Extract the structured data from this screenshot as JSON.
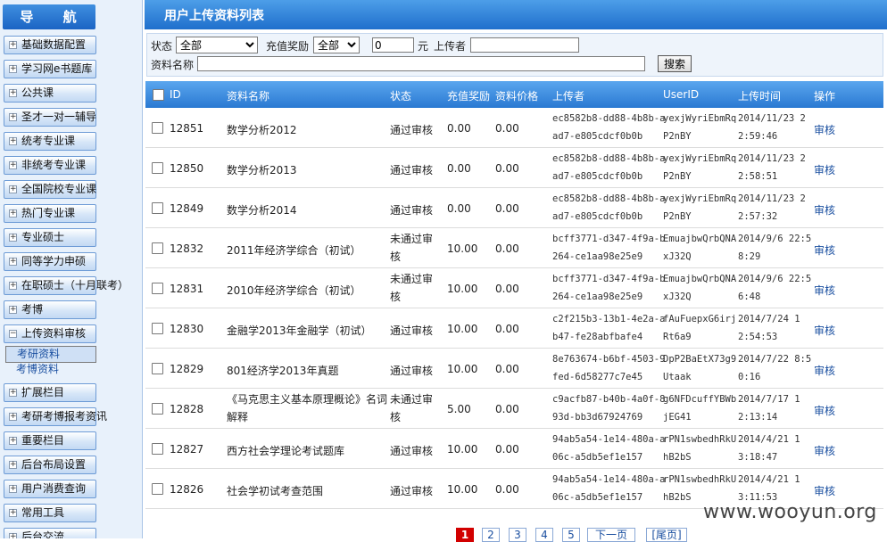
{
  "nav": {
    "title": "导 航",
    "items": [
      {
        "label": "基础数据配置",
        "sign": "+"
      },
      {
        "label": "学习网e书题库",
        "sign": "+"
      },
      {
        "label": "公共课",
        "sign": "+"
      },
      {
        "label": "圣才一对一辅导",
        "sign": "+"
      },
      {
        "label": "统考专业课",
        "sign": "+"
      },
      {
        "label": "非统考专业课",
        "sign": "+"
      },
      {
        "label": "全国院校专业课",
        "sign": "+"
      },
      {
        "label": "热门专业课",
        "sign": "+"
      },
      {
        "label": "专业硕士",
        "sign": "+"
      },
      {
        "label": "同等学力申硕",
        "sign": "+"
      },
      {
        "label": "在职硕士（十月联考）",
        "sign": "+"
      },
      {
        "label": "考博",
        "sign": "+"
      },
      {
        "label": "上传资料审核",
        "sign": "−"
      },
      {
        "label": "扩展栏目",
        "sign": "+"
      },
      {
        "label": "考研考博报考资讯",
        "sign": "+"
      },
      {
        "label": "重要栏目",
        "sign": "+"
      },
      {
        "label": "后台布局设置",
        "sign": "+"
      },
      {
        "label": "用户消费查询",
        "sign": "+"
      },
      {
        "label": "常用工具",
        "sign": "+"
      },
      {
        "label": "后台交流",
        "sign": "+"
      }
    ],
    "sub_items": [
      {
        "label": "考研资料"
      },
      {
        "label": "考博资料"
      }
    ]
  },
  "page": {
    "title": "用户上传资料列表"
  },
  "filters": {
    "status_label": "状态",
    "status_value": "全部",
    "reward_label": "充值奖励",
    "reward_value": "全部",
    "amount_value": "0",
    "yuan_label": "元",
    "uploader_label": "上传者",
    "uploader_value": "",
    "name_label": "资料名称",
    "name_value": "",
    "search_label": "搜索"
  },
  "table": {
    "headers": {
      "id": "ID",
      "name": "资料名称",
      "status": "状态",
      "reward": "充值奖励",
      "price": "资料价格",
      "uploader": "上传者",
      "userid": "UserID",
      "time": "上传时间",
      "action": "操作"
    },
    "rows": [
      {
        "id": "12851",
        "name1": "数学分析2012",
        "name2": "",
        "status1": "通过审核",
        "status2": "",
        "reward": "0.00",
        "price": "0.00",
        "up1": "ec8582b8-dd88-4b8b-a",
        "up2": "ad7-e805cdcf0b0b",
        "uid1": "yexjWyriEbmRq",
        "uid2": "P2nBY",
        "t1": "2014/11/23 2",
        "t2": "2:59:46",
        "action": "审核"
      },
      {
        "id": "12850",
        "name1": "数学分析2013",
        "name2": "",
        "status1": "通过审核",
        "status2": "",
        "reward": "0.00",
        "price": "0.00",
        "up1": "ec8582b8-dd88-4b8b-a",
        "up2": "ad7-e805cdcf0b0b",
        "uid1": "yexjWyriEbmRq",
        "uid2": "P2nBY",
        "t1": "2014/11/23 2",
        "t2": "2:58:51",
        "action": "审核"
      },
      {
        "id": "12849",
        "name1": "数学分析2014",
        "name2": "",
        "status1": "通过审核",
        "status2": "",
        "reward": "0.00",
        "price": "0.00",
        "up1": "ec8582b8-dd88-4b8b-a",
        "up2": "ad7-e805cdcf0b0b",
        "uid1": "yexjWyriEbmRq",
        "uid2": "P2nBY",
        "t1": "2014/11/23 2",
        "t2": "2:57:32",
        "action": "审核"
      },
      {
        "id": "12832",
        "name1": "2011年经济学综合（初试）",
        "name2": "",
        "status1": "未通过审",
        "status2": "核",
        "reward": "10.00",
        "price": "0.00",
        "up1": "bcff3771-d347-4f9a-b",
        "up2": "264-ce1aa98e25e9",
        "uid1": "EmuajbwQrbQNA",
        "uid2": "xJ32Q",
        "t1": "2014/9/6 22:5",
        "t2": "8:29",
        "action": "审核"
      },
      {
        "id": "12831",
        "name1": "2010年经济学综合（初试）",
        "name2": "",
        "status1": "未通过审",
        "status2": "核",
        "reward": "10.00",
        "price": "0.00",
        "up1": "bcff3771-d347-4f9a-b",
        "up2": "264-ce1aa98e25e9",
        "uid1": "EmuajbwQrbQNA",
        "uid2": "xJ32Q",
        "t1": "2014/9/6 22:5",
        "t2": "6:48",
        "action": "审核"
      },
      {
        "id": "12830",
        "name1": "金融学2013年金融学（初试）",
        "name2": "",
        "status1": "通过审核",
        "status2": "",
        "reward": "10.00",
        "price": "0.00",
        "up1": "c2f215b3-13b1-4e2a-a",
        "up2": "b47-fe28abfbafe4",
        "uid1": "fAuFuepxG6irj",
        "uid2": "Rt6a9",
        "t1": "2014/7/24 1",
        "t2": "2:54:53",
        "action": "审核"
      },
      {
        "id": "12829",
        "name1": "801经济学2013年真题",
        "name2": "",
        "status1": "通过审核",
        "status2": "",
        "reward": "10.00",
        "price": "0.00",
        "up1": "8e763674-b6bf-4503-9",
        "up2": "fed-6d58277c7e45",
        "uid1": "DpP2BaEtX73g9",
        "uid2": "Utaak",
        "t1": "2014/7/22 8:5",
        "t2": "0:16",
        "action": "审核"
      },
      {
        "id": "12828",
        "name1": "《马克思主义基本原理概论》名词",
        "name2": "解释",
        "status1": "未通过审",
        "status2": "核",
        "reward": "5.00",
        "price": "0.00",
        "up1": "c9acfb87-b40b-4a0f-8",
        "up2": "93d-bb3d67924769",
        "uid1": "g6NFDcuffYBWb",
        "uid2": "jEG41",
        "t1": "2014/7/17 1",
        "t2": "2:13:14",
        "action": "审核"
      },
      {
        "id": "12827",
        "name1": "西方社会学理论考试题库",
        "name2": "",
        "status1": "通过审核",
        "status2": "",
        "reward": "10.00",
        "price": "0.00",
        "up1": "94ab5a54-1e14-480a-a",
        "up2": "06c-a5db5ef1e157",
        "uid1": "rPN1swbedhRkU",
        "uid2": "hB2bS",
        "t1": "2014/4/21 1",
        "t2": "3:18:47",
        "action": "审核"
      },
      {
        "id": "12826",
        "name1": "社会学初试考查范围",
        "name2": "",
        "status1": "通过审核",
        "status2": "",
        "reward": "10.00",
        "price": "0.00",
        "up1": "94ab5a54-1e14-480a-a",
        "up2": "06c-a5db5ef1e157",
        "uid1": "rPN1swbedhRkU",
        "uid2": "hB2bS",
        "t1": "2014/4/21 1",
        "t2": "3:11:53",
        "action": "审核"
      }
    ]
  },
  "pager": {
    "pages": [
      "1",
      "2",
      "3",
      "4",
      "5"
    ],
    "next": "下一页",
    "last": "[尾页]"
  },
  "watermark": "www.wooyun.org"
}
